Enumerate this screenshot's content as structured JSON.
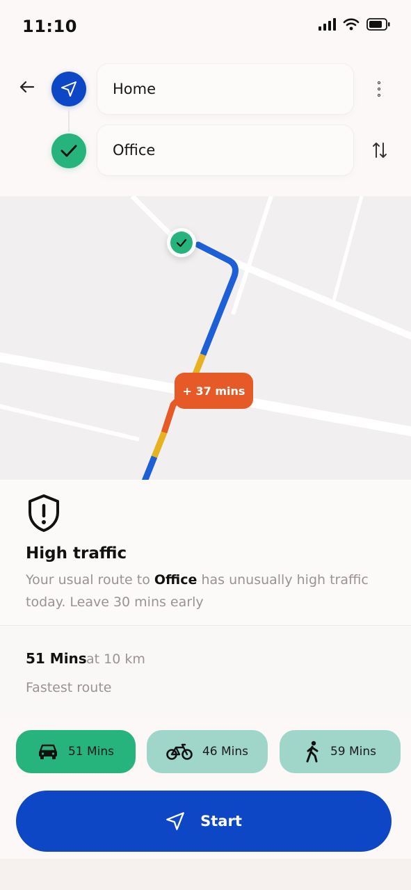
{
  "status_bar": {
    "time": "11:10"
  },
  "route": {
    "origin": "Home",
    "destination": "Office"
  },
  "map": {
    "delay_badge": "+ 37 mins",
    "colors": {
      "route": "#1d5fd6",
      "moderate": "#e6b220",
      "heavy": "#e55a26",
      "destination": "#27b37c"
    }
  },
  "alert": {
    "icon": "shield-warning-icon",
    "title": "High traffic",
    "desc_prefix": "Your usual route to ",
    "desc_bold": "Office",
    "desc_suffix": " has unusually high traffic today. Leave 30 mins early"
  },
  "summary": {
    "duration": "51 Mins",
    "distance": "at 10 km",
    "subtitle": "Fastest route"
  },
  "modes": [
    {
      "label": "51 Mins",
      "icon": "car-icon",
      "selected": true
    },
    {
      "label": "46 Mins",
      "icon": "bike-icon",
      "selected": false
    },
    {
      "label": "59 Mins",
      "icon": "walk-icon",
      "selected": false
    }
  ],
  "start_button": {
    "label": "Start",
    "icon": "navigation-arrow-icon"
  }
}
